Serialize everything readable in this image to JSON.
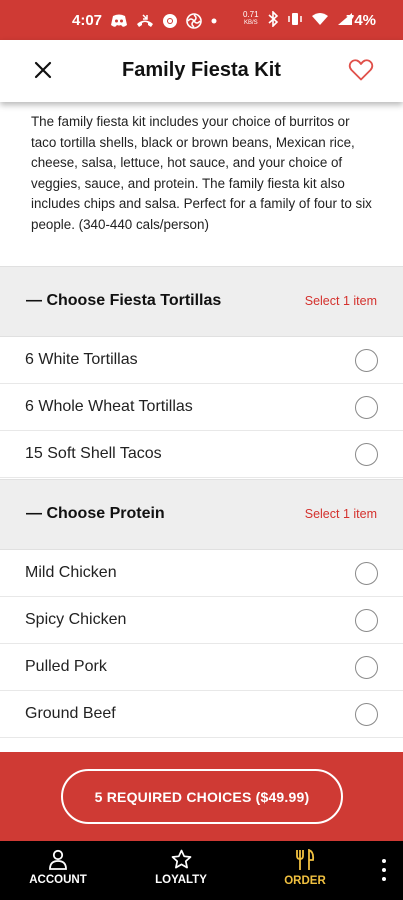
{
  "status_bar": {
    "time": "4:07",
    "network_speed_value": "0.71",
    "network_speed_unit": "KB/S",
    "battery": "74%"
  },
  "header": {
    "title": "Family Fiesta Kit"
  },
  "description": "The family fiesta kit includes your choice of burritos or taco tortilla shells, black or brown beans, Mexican rice, cheese, salsa, lettuce, hot sauce, and your choice of veggies, sauce, and protein. The family fiesta kit also includes chips and salsa. Perfect for a family of four to six people. (340-440 cals/person)",
  "sections": [
    {
      "title": "— Choose Fiesta Tortillas",
      "requirement": "Select 1 item",
      "options": [
        "6 White Tortillas",
        "6 Whole Wheat Tortillas",
        "15 Soft Shell Tacos"
      ]
    },
    {
      "title": "— Choose Protein",
      "requirement": "Select 1 item",
      "options": [
        "Mild Chicken",
        "Spicy Chicken",
        "Pulled Pork",
        "Ground Beef"
      ]
    }
  ],
  "cta": {
    "label": "5 REQUIRED CHOICES ($49.99)"
  },
  "bottom_nav": {
    "account": "ACCOUNT",
    "loyalty": "LOYALTY",
    "order": "ORDER"
  },
  "colors": {
    "brand_red": "#cf3a34",
    "accent_red": "#d4312d",
    "active_nav": "#f0c040"
  }
}
